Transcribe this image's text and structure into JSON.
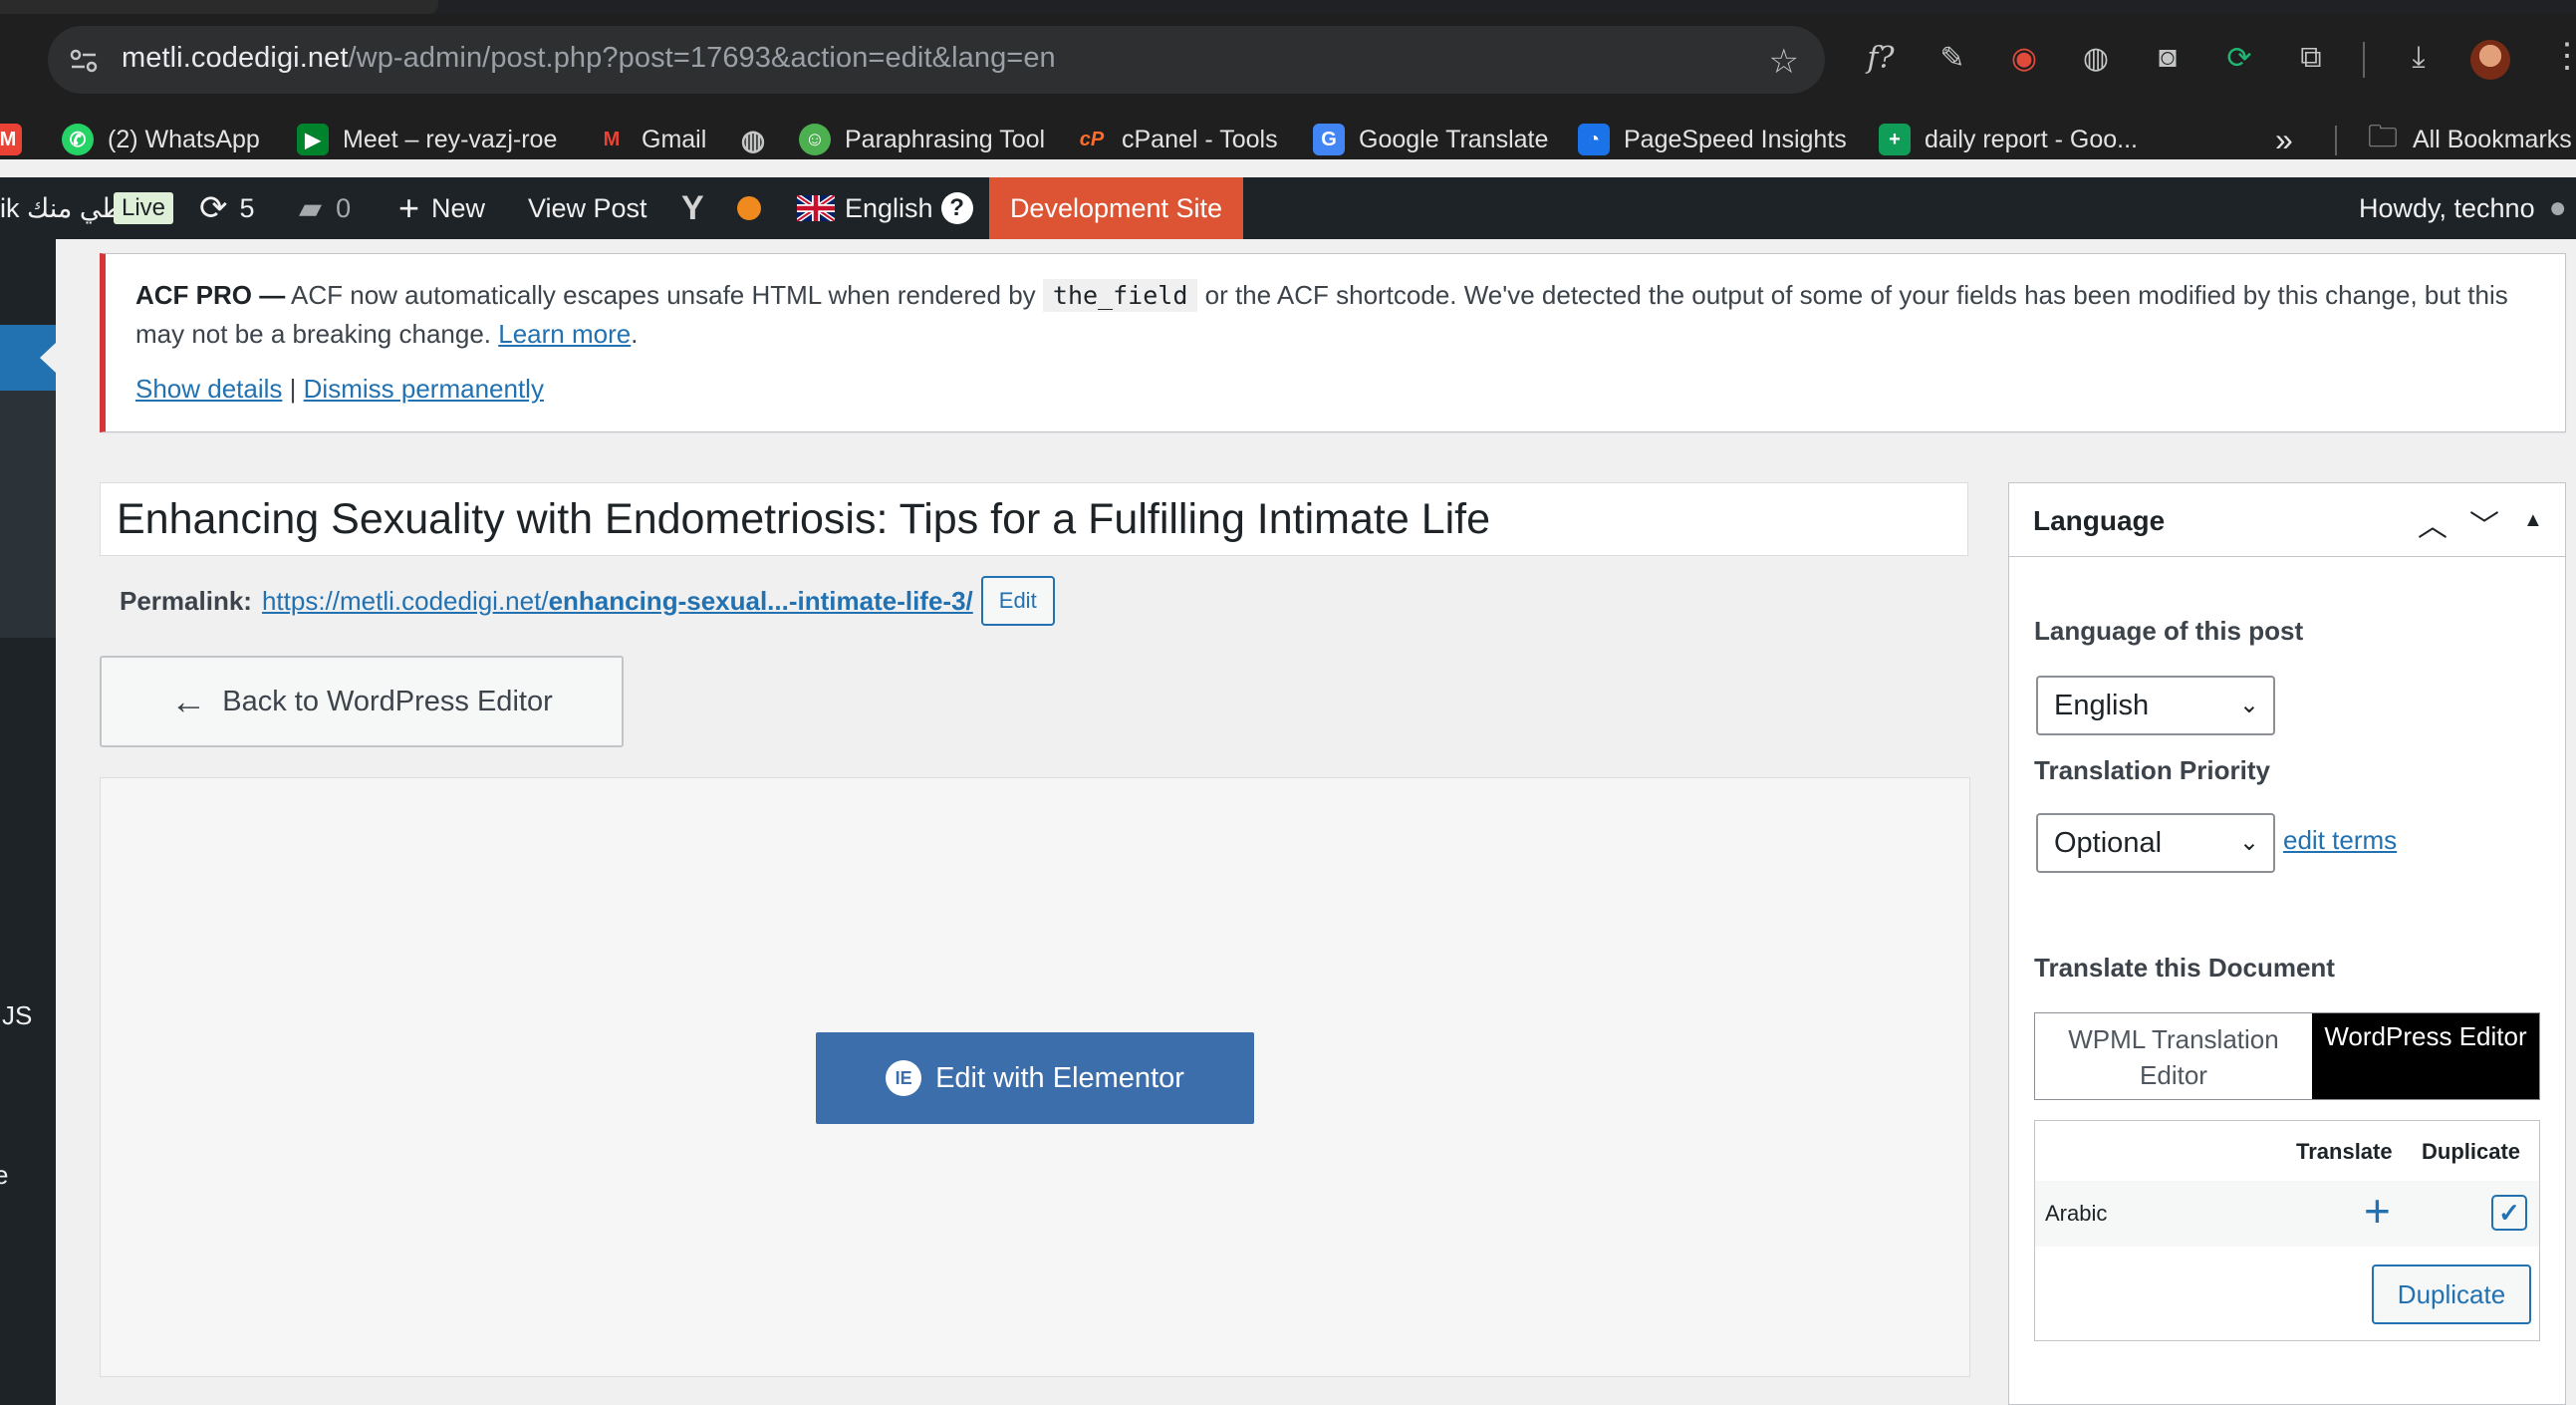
{
  "browser": {
    "url_host": "metli.codedigi.net",
    "url_path": "/wp-admin/post.php?post=17693&action=edit&lang=en",
    "bookmarks": [
      {
        "label": "(2) WhatsApp",
        "color": "#25d366",
        "glyph": "✆"
      },
      {
        "label": "Meet – rey-vazj-roe",
        "color": "#00832d",
        "glyph": "▶"
      },
      {
        "label": "Gmail",
        "color": "#ea4335",
        "glyph": "M"
      },
      {
        "label": "",
        "color": "#5f6368",
        "glyph": "◍"
      },
      {
        "label": "Paraphrasing Tool",
        "color": "#4caf50",
        "glyph": "☺"
      },
      {
        "label": "cPanel - Tools",
        "color": "#ff6c2c",
        "glyph": "cP"
      },
      {
        "label": "Google Translate",
        "color": "#4285f4",
        "glyph": "G"
      },
      {
        "label": "PageSpeed Insights",
        "color": "#1a73e8",
        "glyph": "◔"
      },
      {
        "label": "daily report - Goo...",
        "color": "#0f9d58",
        "glyph": "+"
      }
    ],
    "bookmarks_more": "»",
    "all_bookmarks": "All Bookmarks"
  },
  "adminbar": {
    "site_name": "ik مطي منك",
    "live": "Live",
    "updates_count": "5",
    "comments_count": "0",
    "new_label": "New",
    "view_post": "View Post",
    "language": "English",
    "dev_site": "Development Site",
    "howdy": "Howdy, techno"
  },
  "sidebar": {
    "text_js": "JS",
    "text_e": "e"
  },
  "acf_notice": {
    "prefix": "ACF PRO —",
    "text_a": "ACF now automatically escapes unsafe HTML when rendered by",
    "code": "the_field",
    "text_b": "or the ACF shortcode. We've detected the output of some of your fields has been modified by this change, but this may not be a breaking change.",
    "learn_more": "Learn more",
    "show_details": "Show details",
    "separator": "|",
    "dismiss": "Dismiss permanently"
  },
  "post": {
    "title": "Enhancing Sexuality with Endometriosis: Tips for a Fulfilling Intimate Life",
    "permalink_label": "Permalink:",
    "permalink_base": "https://metli.codedigi.net/",
    "permalink_slug": "enhancing-sexual...-intimate-life-3/",
    "permalink_edit": "Edit",
    "back_button": "Back to WordPress Editor",
    "elementor_button": "Edit with Elementor"
  },
  "language_box": {
    "title": "Language",
    "language_of_post_label": "Language of this post",
    "language_value": "English",
    "translation_priority_label": "Translation Priority",
    "priority_value": "Optional",
    "edit_terms": "edit terms",
    "translate_doc_label": "Translate this Document",
    "tab_wpml": "WPML Translation Editor",
    "tab_wp": "WordPress Editor",
    "col_translate": "Translate",
    "col_duplicate": "Duplicate",
    "row_language": "Arabic",
    "duplicate_button": "Duplicate"
  }
}
